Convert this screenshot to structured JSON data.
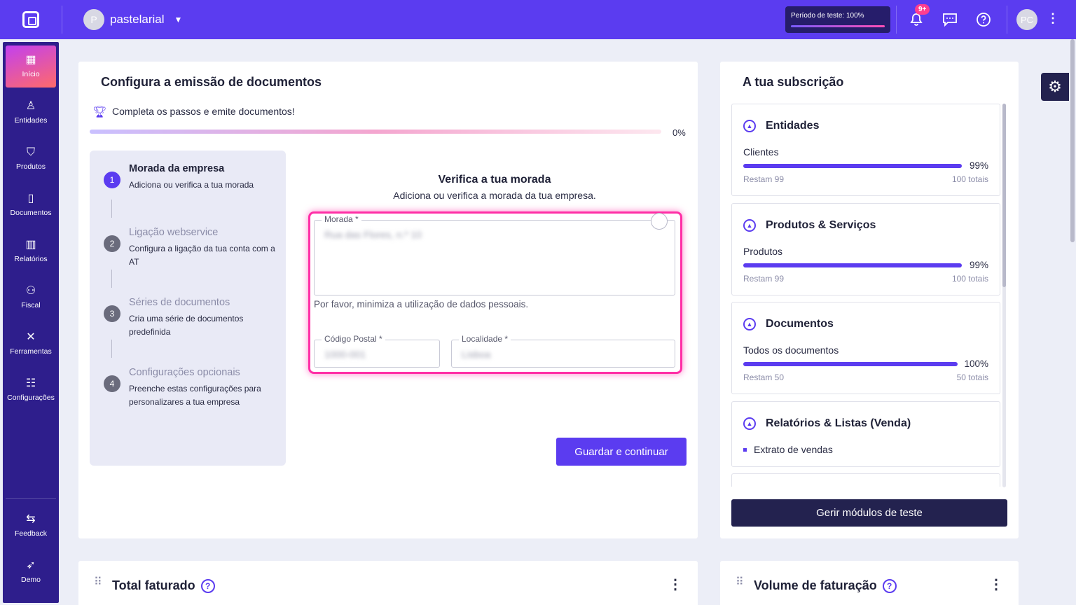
{
  "topbar": {
    "account_initial": "P",
    "account_name": "pastelarial",
    "trial_label": "Período de teste: 100%",
    "notifications_badge": "9+",
    "user_initials": "PC"
  },
  "sidebar": {
    "items": [
      {
        "label": "Início",
        "icon": "home-grid-icon"
      },
      {
        "label": "Entidades",
        "icon": "user-icon"
      },
      {
        "label": "Produtos",
        "icon": "basket-icon"
      },
      {
        "label": "Documentos",
        "icon": "document-icon"
      },
      {
        "label": "Relatórios",
        "icon": "chart-icon"
      },
      {
        "label": "Fiscal",
        "icon": "hierarchy-icon"
      },
      {
        "label": "Ferramentas",
        "icon": "tools-icon"
      },
      {
        "label": "Configurações",
        "icon": "sliders-icon"
      }
    ],
    "bottom": [
      {
        "label": "Feedback",
        "icon": "feedback-icon"
      },
      {
        "label": "Demo",
        "icon": "rocket-icon"
      }
    ]
  },
  "setup": {
    "title": "Configura a emissão de documentos",
    "progress_text": "Completa os passos e emite documentos!",
    "progress_pct": "0%",
    "steps": [
      {
        "num": "1",
        "title": "Morada da empresa",
        "desc": "Adiciona ou verifica a tua morada"
      },
      {
        "num": "2",
        "title": "Ligação webservice",
        "desc": "Configura a ligação da tua conta com a AT"
      },
      {
        "num": "3",
        "title": "Séries de documentos",
        "desc": "Cria uma série de documentos predefinida"
      },
      {
        "num": "4",
        "title": "Configurações opcionais",
        "desc": "Preenche estas configurações para personalizares a tua empresa"
      }
    ],
    "form_title": "Verifica a tua morada",
    "form_subtitle": "Adiciona ou verifica a morada da tua empresa.",
    "address_label": "Morada *",
    "address_value": "Rua das Flores, n.º 10",
    "hint": "Por favor, minimiza a utilização de dados pessoais.",
    "postal_label": "Código Postal *",
    "postal_value": "1000-001",
    "locality_label": "Localidade *",
    "locality_value": "Lisboa",
    "save_button": "Guardar e continuar"
  },
  "subscription": {
    "title": "A tua subscrição",
    "modules": [
      {
        "name": "Entidades",
        "label": "Clientes",
        "pct": "99%",
        "fill": 0.99,
        "remaining": "Restam 99",
        "total": "100 totais"
      },
      {
        "name": "Produtos & Serviços",
        "label": "Produtos",
        "pct": "99%",
        "fill": 0.99,
        "remaining": "Restam 99",
        "total": "100 totais"
      },
      {
        "name": "Documentos",
        "label": "Todos os documentos",
        "pct": "100%",
        "fill": 1.0,
        "remaining": "Restam 50",
        "total": "50 totais"
      },
      {
        "name": "Relatórios & Listas (Venda)",
        "bullet": "Extrato de vendas"
      }
    ],
    "manage_button": "Gerir módulos de teste"
  },
  "widgets": {
    "total_faturado": "Total faturado",
    "volume_faturacao": "Volume de faturação"
  },
  "colors": {
    "brand": "#5b3cf0",
    "sidebar": "#2e1e8c",
    "highlight": "#ff2fa6",
    "dark_button": "#23224f"
  }
}
